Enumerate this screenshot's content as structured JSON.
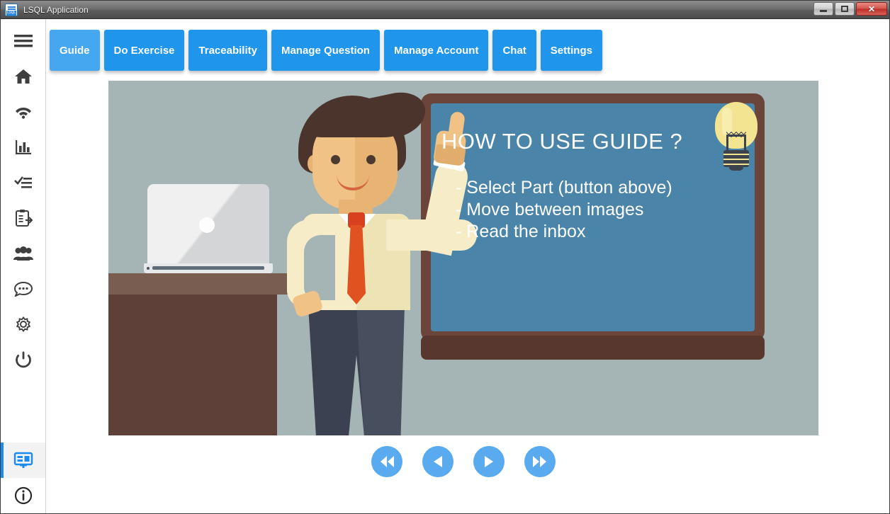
{
  "window": {
    "title": "LSQL Application",
    "app_icon": "document-icon",
    "app_icon_tag": "LSQL",
    "controls": {
      "minimize": "minimize-button",
      "maximize": "maximize-button",
      "close": "close-button",
      "close_label": "✕"
    }
  },
  "sidebar": {
    "items": [
      {
        "name": "menu-icon",
        "label": "Menu"
      },
      {
        "name": "home-icon",
        "label": "Home"
      },
      {
        "name": "wifi-icon",
        "label": "Connection"
      },
      {
        "name": "bar-chart-icon",
        "label": "Statistics"
      },
      {
        "name": "checklist-icon",
        "label": "Tasks"
      },
      {
        "name": "clipboard-import-icon",
        "label": "Exercises"
      },
      {
        "name": "users-icon",
        "label": "Users"
      },
      {
        "name": "chat-icon",
        "label": "Chat"
      },
      {
        "name": "gear-icon",
        "label": "Settings"
      },
      {
        "name": "power-icon",
        "label": "Log out"
      }
    ],
    "bottom_items": [
      {
        "name": "presentation-icon",
        "label": "Guide",
        "active": true
      },
      {
        "name": "info-icon",
        "label": "About",
        "active": false
      }
    ]
  },
  "tabs": [
    {
      "label": "Guide",
      "active": true
    },
    {
      "label": "Do Exercise",
      "active": false
    },
    {
      "label": "Traceability",
      "active": false
    },
    {
      "label": "Manage Question",
      "active": false
    },
    {
      "label": "Manage Account",
      "active": false
    },
    {
      "label": "Chat",
      "active": false
    },
    {
      "label": "Settings",
      "active": false
    }
  ],
  "slide": {
    "board_title": "HOW TO USE GUIDE ?",
    "board_lines": [
      "- Select Part (button above)",
      "- Move between images",
      "- Read the inbox"
    ],
    "bulb_icon": "lightbulb-icon"
  },
  "navigation": [
    {
      "name": "first-slide-button",
      "icon": "rewind-icon"
    },
    {
      "name": "previous-slide-button",
      "icon": "previous-icon"
    },
    {
      "name": "next-slide-button",
      "icon": "next-icon"
    },
    {
      "name": "last-slide-button",
      "icon": "fast-forward-icon"
    }
  ],
  "colors": {
    "accent": "#1f95ec",
    "accent_active": "#45a7f0",
    "nav_button": "#5aaaf0",
    "illustration_bg": "#a5b4b4",
    "board": "#4a84a8",
    "board_frame": "#6b4539"
  }
}
